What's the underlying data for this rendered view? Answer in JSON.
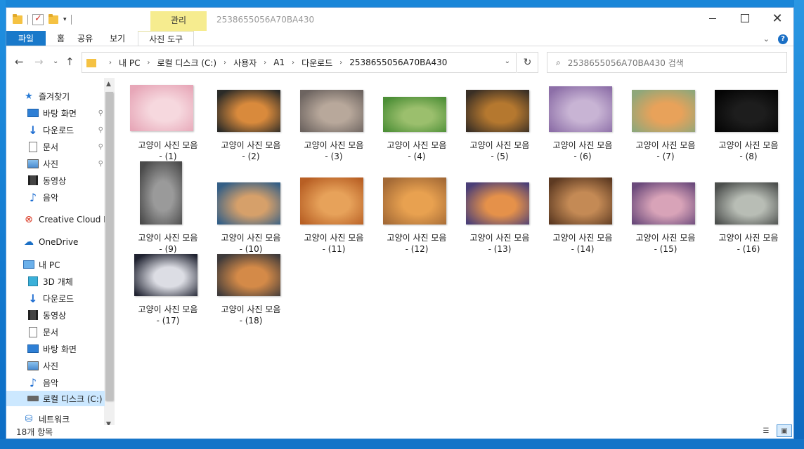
{
  "window": {
    "title": "2538655056A70BA430",
    "context_tab_group": "관리"
  },
  "ribbon": {
    "tabs": [
      {
        "label": "파일"
      },
      {
        "label": "홈"
      },
      {
        "label": "공유"
      },
      {
        "label": "보기"
      },
      {
        "label": "사진 도구"
      }
    ]
  },
  "address": {
    "crumbs": [
      "내 PC",
      "로컬 디스크 (C:)",
      "사용자",
      "A1",
      "다운로드",
      "2538655056A70BA430"
    ]
  },
  "search": {
    "placeholder": "2538655056A70BA430 검색"
  },
  "navigation": {
    "items": [
      {
        "label": "즐겨찾기",
        "icon": "star-icon",
        "pinned": false
      },
      {
        "label": "바탕 화면",
        "icon": "desktop-icon",
        "pinned": true
      },
      {
        "label": "다운로드",
        "icon": "download-icon",
        "pinned": true
      },
      {
        "label": "문서",
        "icon": "document-icon",
        "pinned": true
      },
      {
        "label": "사진",
        "icon": "pictures-icon",
        "pinned": true
      },
      {
        "label": "동영상",
        "icon": "video-icon",
        "pinned": false
      },
      {
        "label": "음악",
        "icon": "music-icon",
        "pinned": false
      },
      {
        "label": "Creative Cloud Fil",
        "icon": "creative-cloud-icon",
        "pinned": false
      },
      {
        "label": "OneDrive",
        "icon": "onedrive-icon",
        "pinned": false
      },
      {
        "label": "내 PC",
        "icon": "pc-icon",
        "pinned": false
      },
      {
        "label": "3D 개체",
        "icon": "3d-objects-icon",
        "pinned": false
      },
      {
        "label": "다운로드",
        "icon": "download-icon",
        "pinned": false
      },
      {
        "label": "동영상",
        "icon": "video-icon",
        "pinned": false
      },
      {
        "label": "문서",
        "icon": "document-icon",
        "pinned": false
      },
      {
        "label": "바탕 화면",
        "icon": "desktop-icon",
        "pinned": false
      },
      {
        "label": "사진",
        "icon": "pictures-icon",
        "pinned": false
      },
      {
        "label": "음악",
        "icon": "music-icon",
        "pinned": false
      },
      {
        "label": "로컬 디스크 (C:)",
        "icon": "local-disk-icon",
        "pinned": false,
        "selected": true
      },
      {
        "label": "네트워크",
        "icon": "network-icon",
        "pinned": false
      }
    ]
  },
  "files": [
    {
      "line1": "고양이 사진 모음",
      "line2": "- (1)",
      "colors": [
        "#e7a7b8",
        "#f6d8de"
      ]
    },
    {
      "line1": "고양이 사진 모음",
      "line2": "- (2)",
      "colors": [
        "#2b2b28",
        "#d98a3c"
      ]
    },
    {
      "line1": "고양이 사진 모음",
      "line2": "- (3)",
      "colors": [
        "#6d6460",
        "#b8a89b"
      ]
    },
    {
      "line1": "고양이 사진 모음",
      "line2": "- (4)",
      "colors": [
        "#4d8f37",
        "#9bbf6d"
      ]
    },
    {
      "line1": "고양이 사진 모음",
      "line2": "- (5)",
      "colors": [
        "#3a2f25",
        "#b5782f"
      ]
    },
    {
      "line1": "고양이 사진 모음",
      "line2": "- (6)",
      "colors": [
        "#8d6fa8",
        "#c8b4d4"
      ]
    },
    {
      "line1": "고양이 사진 모음",
      "line2": "- (7)",
      "colors": [
        "#8fa77a",
        "#e8a25a"
      ]
    },
    {
      "line1": "고양이 사진 모음",
      "line2": "- (8)",
      "colors": [
        "#050505",
        "#1d1d1d"
      ]
    },
    {
      "line1": "고양이 사진 모음",
      "line2": "- (9)",
      "colors": [
        "#4a4a4a",
        "#9a9a9a"
      ]
    },
    {
      "line1": "고양이 사진 모음",
      "line2": "- (10)",
      "colors": [
        "#345f86",
        "#d6a06a"
      ]
    },
    {
      "line1": "고양이 사진 모음",
      "line2": "- (11)",
      "colors": [
        "#b85f24",
        "#e7a25a"
      ]
    },
    {
      "line1": "고양이 사진 모음",
      "line2": "- (12)",
      "colors": [
        "#a46a36",
        "#e8a150"
      ]
    },
    {
      "line1": "고양이 사진 모음",
      "line2": "- (13)",
      "colors": [
        "#4b3f77",
        "#e5914a"
      ]
    },
    {
      "line1": "고양이 사진 모음",
      "line2": "- (14)",
      "colors": [
        "#5d3a22",
        "#c48a55"
      ]
    },
    {
      "line1": "고양이 사진 모음",
      "line2": "- (15)",
      "colors": [
        "#6b4a7b",
        "#d8a3b8"
      ]
    },
    {
      "line1": "고양이 사진 모음",
      "line2": "- (16)",
      "colors": [
        "#4c4f4d",
        "#b8bdb5"
      ]
    },
    {
      "line1": "고양이 사진 모음",
      "line2": "- (17)",
      "colors": [
        "#1f2230",
        "#dcdde4"
      ]
    },
    {
      "line1": "고양이 사진 모음",
      "line2": "- (18)",
      "colors": [
        "#3e3a3a",
        "#d48a48"
      ]
    }
  ],
  "status": {
    "item_count": "18개 항목"
  }
}
